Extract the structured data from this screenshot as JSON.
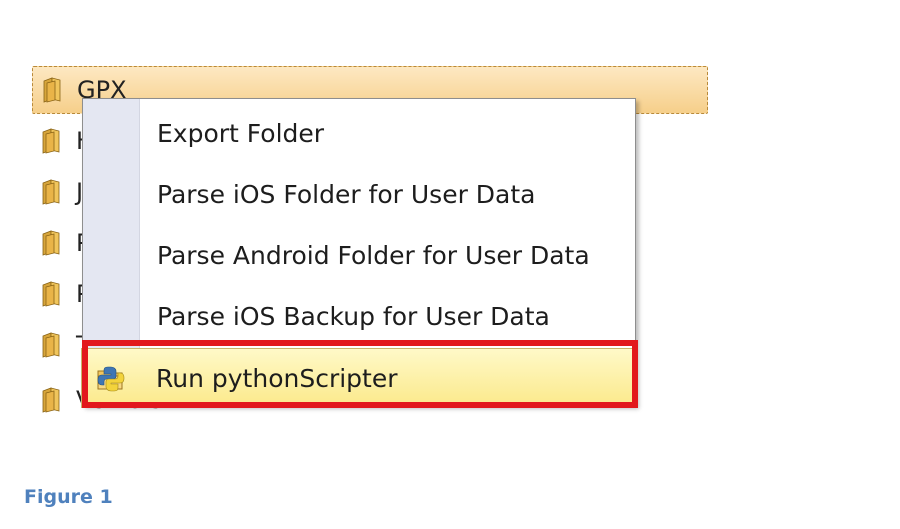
{
  "tree": {
    "items": [
      {
        "label": "GPX"
      },
      {
        "label": "H"
      },
      {
        "label": "J"
      },
      {
        "label": "P"
      },
      {
        "label": "P"
      },
      {
        "label": "T"
      },
      {
        "label": "Vehicle"
      }
    ]
  },
  "context_menu": {
    "items": [
      {
        "label": "Export Folder"
      },
      {
        "label": "Parse iOS Folder for User Data"
      },
      {
        "label": "Parse Android Folder for User Data"
      },
      {
        "label": "Parse iOS Backup for User Data"
      },
      {
        "label": "Run pythonScripter",
        "icon": "python-folder-icon"
      }
    ]
  },
  "caption": "Figure 1",
  "colors": {
    "selection": "#f6cf8a",
    "highlight": "#fbe98a",
    "annotation_red": "#e2181c",
    "caption_blue": "#4f81bd"
  }
}
